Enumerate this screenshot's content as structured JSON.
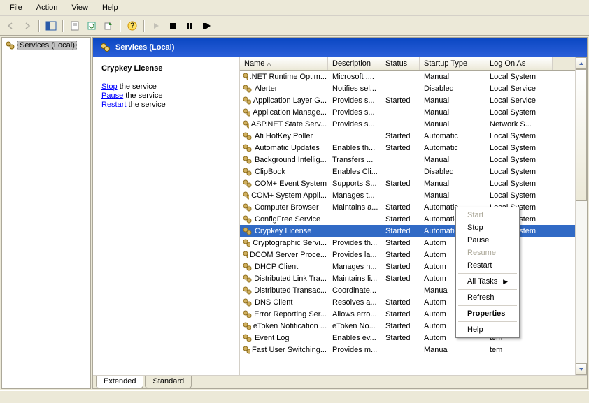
{
  "menu": {
    "items": [
      "File",
      "Action",
      "View",
      "Help"
    ]
  },
  "header": {
    "title": "Services (Local)"
  },
  "tree": {
    "root": "Services (Local)"
  },
  "details": {
    "title": "Crypkey License",
    "actions": [
      {
        "link": "Stop",
        "rest": " the service"
      },
      {
        "link": "Pause",
        "rest": " the service"
      },
      {
        "link": "Restart",
        "rest": " the service"
      }
    ]
  },
  "columns": [
    "Name",
    "Description",
    "Status",
    "Startup Type",
    "Log On As"
  ],
  "services": [
    {
      "name": ".NET Runtime Optim...",
      "desc": "Microsoft ....",
      "status": "",
      "startup": "Manual",
      "logon": "Local System"
    },
    {
      "name": "Alerter",
      "desc": "Notifies sel...",
      "status": "",
      "startup": "Disabled",
      "logon": "Local Service"
    },
    {
      "name": "Application Layer G...",
      "desc": "Provides s...",
      "status": "Started",
      "startup": "Manual",
      "logon": "Local Service"
    },
    {
      "name": "Application Manage...",
      "desc": "Provides s...",
      "status": "",
      "startup": "Manual",
      "logon": "Local System"
    },
    {
      "name": "ASP.NET State Serv...",
      "desc": "Provides s...",
      "status": "",
      "startup": "Manual",
      "logon": "Network S..."
    },
    {
      "name": "Ati HotKey Poller",
      "desc": "",
      "status": "Started",
      "startup": "Automatic",
      "logon": "Local System"
    },
    {
      "name": "Automatic Updates",
      "desc": "Enables th...",
      "status": "Started",
      "startup": "Automatic",
      "logon": "Local System"
    },
    {
      "name": "Background Intellig...",
      "desc": "Transfers ...",
      "status": "",
      "startup": "Manual",
      "logon": "Local System"
    },
    {
      "name": "ClipBook",
      "desc": "Enables Cli...",
      "status": "",
      "startup": "Disabled",
      "logon": "Local System"
    },
    {
      "name": "COM+ Event System",
      "desc": "Supports S...",
      "status": "Started",
      "startup": "Manual",
      "logon": "Local System"
    },
    {
      "name": "COM+ System Appli...",
      "desc": "Manages t...",
      "status": "",
      "startup": "Manual",
      "logon": "Local System"
    },
    {
      "name": "Computer Browser",
      "desc": "Maintains a...",
      "status": "Started",
      "startup": "Automatic",
      "logon": "Local System"
    },
    {
      "name": "ConfigFree Service",
      "desc": "",
      "status": "Started",
      "startup": "Automatic",
      "logon": "Local System"
    },
    {
      "name": "Crypkey License",
      "desc": "",
      "status": "Started",
      "startup": "Automatic",
      "logon": "Local System",
      "selected": true
    },
    {
      "name": "Cryptographic Servi...",
      "desc": "Provides th...",
      "status": "Started",
      "startup": "Autom",
      "logon": "tem"
    },
    {
      "name": "DCOM Server Proce...",
      "desc": "Provides la...",
      "status": "Started",
      "startup": "Autom",
      "logon": "tem"
    },
    {
      "name": "DHCP Client",
      "desc": "Manages n...",
      "status": "Started",
      "startup": "Autom",
      "logon": "tem"
    },
    {
      "name": "Distributed Link Tra...",
      "desc": "Maintains li...",
      "status": "Started",
      "startup": "Autom",
      "logon": "tem"
    },
    {
      "name": "Distributed Transac...",
      "desc": "Coordinate...",
      "status": "",
      "startup": "Manua",
      "logon": "S..."
    },
    {
      "name": "DNS Client",
      "desc": "Resolves a...",
      "status": "Started",
      "startup": "Autom",
      "logon": "S..."
    },
    {
      "name": "Error Reporting Ser...",
      "desc": "Allows erro...",
      "status": "Started",
      "startup": "Autom",
      "logon": "tem"
    },
    {
      "name": "eToken Notification ...",
      "desc": "eToken No...",
      "status": "Started",
      "startup": "Autom",
      "logon": "tem"
    },
    {
      "name": "Event Log",
      "desc": "Enables ev...",
      "status": "Started",
      "startup": "Autom",
      "logon": "tem"
    },
    {
      "name": "Fast User Switching...",
      "desc": "Provides m...",
      "status": "",
      "startup": "Manua",
      "logon": "tem"
    }
  ],
  "context_menu": {
    "items": [
      {
        "label": "Start",
        "disabled": true
      },
      {
        "label": "Stop"
      },
      {
        "label": "Pause"
      },
      {
        "label": "Resume",
        "disabled": true
      },
      {
        "label": "Restart"
      },
      {
        "sep": true
      },
      {
        "label": "All Tasks",
        "submenu": true
      },
      {
        "sep": true
      },
      {
        "label": "Refresh"
      },
      {
        "sep": true
      },
      {
        "label": "Properties",
        "bold": true
      },
      {
        "sep": true
      },
      {
        "label": "Help"
      }
    ]
  },
  "tabs": [
    {
      "label": "Extended",
      "active": true
    },
    {
      "label": "Standard"
    }
  ]
}
